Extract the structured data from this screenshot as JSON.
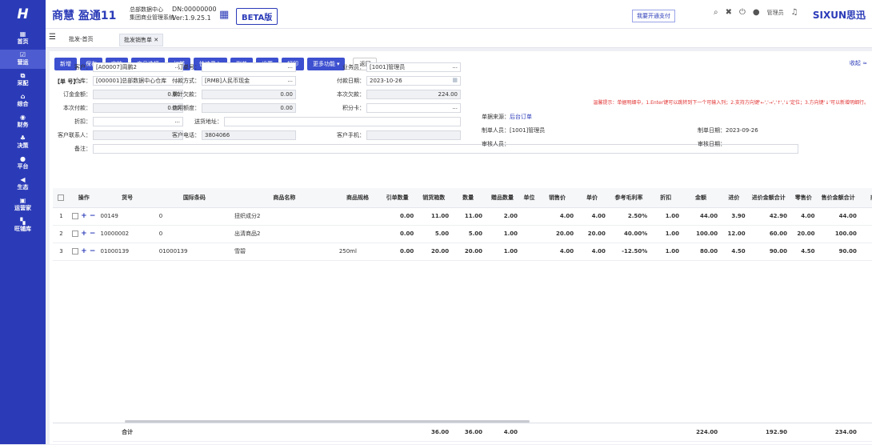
{
  "sidebar": {
    "logo": "H",
    "items": [
      {
        "icon": "▦",
        "label": "首页"
      },
      {
        "icon": "☑",
        "label": "营运",
        "active": true
      },
      {
        "icon": "⧉",
        "label": "采配"
      },
      {
        "icon": "⌂",
        "label": "综合"
      },
      {
        "icon": "◉",
        "label": "财务"
      },
      {
        "icon": "♣",
        "label": "决策"
      },
      {
        "icon": "●",
        "label": "平台"
      },
      {
        "icon": "◀",
        "label": "生态"
      },
      {
        "icon": "▣",
        "label": "运营家"
      },
      {
        "icon": "▚",
        "label": "旺铺库"
      }
    ]
  },
  "header": {
    "brand": "商慧 盈通11",
    "org_line1": "总部数据中心",
    "org_line2": "集团商业管理系统",
    "dn": "DN:00000000",
    "version": "Ver:1.9.25.1",
    "beta": "BETA版",
    "pay_button": "我要开通支付",
    "user": "管理员",
    "company_logo": "SIXUN思迅"
  },
  "tabs": [
    {
      "label": "批发-首页"
    },
    {
      "label": "批发销售单 ✕"
    }
  ],
  "toolbar": {
    "buttons": [
      "新增",
      "保存",
      "审核",
      "商品选择",
      "扫描",
      "快速录入",
      "删单",
      "设置",
      "打印",
      "更多功能 ▾"
    ],
    "back": "返回",
    "collapse": "收起 ≈"
  },
  "doc": {
    "number_label": "【单  号】:"
  },
  "hint": "温馨提示：单据明细中，1.Enter键可以跳转到下一个可输入列；2.支持方向键'←','→','↑','↓'定位；3.方向键'↓'可以新增明细行。",
  "form": {
    "customer_label": "客户：",
    "customer": "[A00007]周鹏2",
    "order_no_label": "订单号：",
    "order_no": "",
    "salesman_label": "业务员：",
    "salesman": "[1001]管理员",
    "warehouse_label": "仓库：",
    "warehouse": "[000001]总部数据中心仓库",
    "pay_method_label": "付款方式：",
    "pay_method": "[RMB]人民币现金",
    "pay_date_label": "付款日期：",
    "pay_date": "2023-10-26",
    "order_amount_label": "订金金额：",
    "order_amount": "0.00",
    "total_owed_label": "累计欠款：",
    "total_owed": "0.00",
    "this_owed_label": "本次欠款：",
    "this_owed": "224.00",
    "this_paid_label": "本次付款：",
    "this_paid": "0.00",
    "credit_label": "信用额度：",
    "credit": "0.00",
    "points_label": "积分卡：",
    "points": "",
    "discount_label": "折扣：",
    "discount": "",
    "address_label": "送货地址：",
    "address": "",
    "contact_label": "客户联系人：",
    "contact": "",
    "phone_label": "客户电话：",
    "phone": "3804066",
    "mobile_label": "客户手机：",
    "mobile": "",
    "remark_label": "备注：",
    "remark": ""
  },
  "info": {
    "source_label": "单据来源：",
    "source": "后台订单",
    "maker_label": "制单人员：[1001]管理员",
    "make_date_label": "制单日期：2023-09-26",
    "auditor_label": "审核人员：",
    "audit_date_label": "审核日期："
  },
  "table": {
    "headers": [
      "",
      "操作",
      "货号",
      "国际条码",
      "商品名称",
      "商品规格",
      "引单数量",
      "销货箱数",
      "数量",
      "赠品数量",
      "单位",
      "销售价",
      "单价",
      "参考毛利率",
      "折扣",
      "金额",
      "进价",
      "进价金额合计",
      "零售价",
      "售价金额合计",
      "商品"
    ],
    "rows": [
      [
        "1",
        "00149",
        "0",
        "扭织成分2",
        "",
        "0.00",
        "11.00",
        "11.00",
        "2.00",
        "",
        "4.00",
        "4.00",
        "2.50%",
        "1.00",
        "44.00",
        "3.90",
        "42.90",
        "4.00",
        "44.00"
      ],
      [
        "2",
        "10000002",
        "0",
        "出清商品2",
        "",
        "0.00",
        "5.00",
        "5.00",
        "1.00",
        "",
        "20.00",
        "20.00",
        "40.00%",
        "1.00",
        "100.00",
        "12.00",
        "60.00",
        "20.00",
        "100.00"
      ],
      [
        "3",
        "01000139",
        "01000139",
        "雪碧",
        "250ml",
        "0.00",
        "20.00",
        "20.00",
        "1.00",
        "",
        "4.00",
        "4.00",
        "-12.50%",
        "1.00",
        "80.00",
        "4.50",
        "90.00",
        "4.50",
        "90.00"
      ]
    ],
    "footer": {
      "label": "合计",
      "box_total": "36.00",
      "qty_total": "36.00",
      "gift_total": "4.00",
      "amount_total": "224.00",
      "cost_total": "192.90",
      "sale_total": "234.00"
    }
  }
}
